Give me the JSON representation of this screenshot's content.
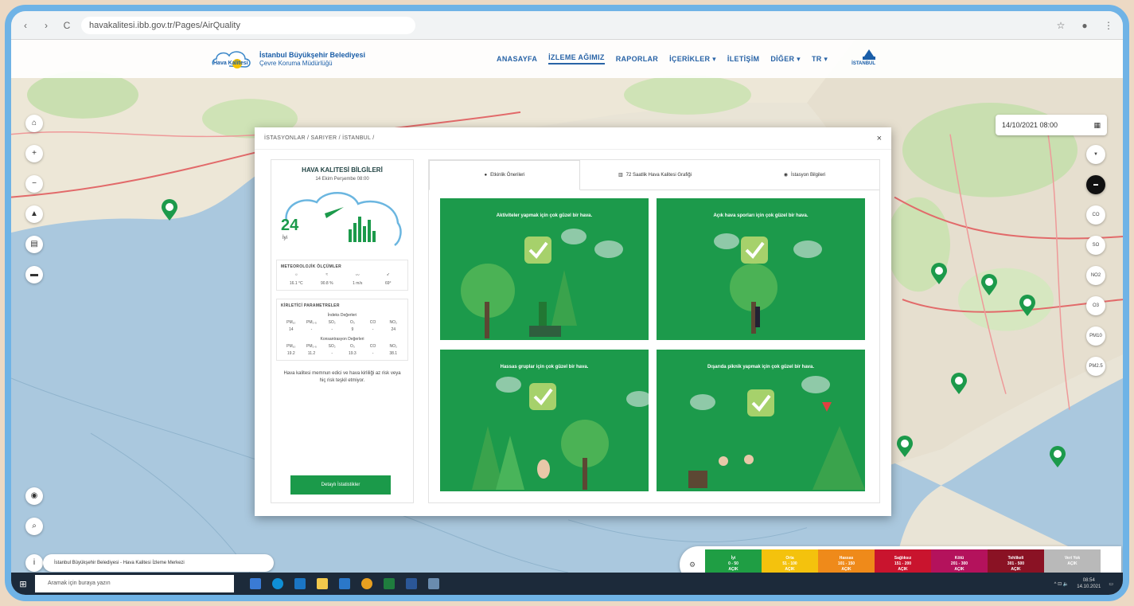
{
  "browser": {
    "url": "havakalitesi.ibb.gov.tr/Pages/AirQuality",
    "back_icon": "‹",
    "forward_icon": "›",
    "reload_icon": "C"
  },
  "header": {
    "logo_name": "Hava Kalitesi",
    "org_line1": "İstanbul Büyükşehir Belediyesi",
    "org_line2": "Çevre Koruma Müdürlüğü",
    "nav": [
      "ANASAYFA",
      "İZLEME AĞIMIZ",
      "RAPORLAR",
      "İÇERİKLER ▾",
      "İLETİŞİM",
      "DİĞER ▾",
      "TR ▾"
    ],
    "active_nav": "İZLEME AĞIMIZ",
    "ibb_label": "İSTANBUL"
  },
  "map": {
    "date": "14/10/2021 08:00",
    "right_buttons": [
      "",
      "",
      "CO",
      "SO",
      "NO2",
      "O3",
      "PM10",
      "PM2.5"
    ]
  },
  "modal": {
    "breadcrumb": "İSTASYONLAR / SARIYER / İSTANBUL /",
    "close": "×",
    "info": {
      "title": "HAVA KALITESİ BİLGİLERİ",
      "date": "14 Ekim Perşembe 08:00",
      "aqi": "24",
      "aqi_label": "İyi",
      "met_title": "METEOROLOJİK ÖLÇÜMLER",
      "met_icons": [
        "☼",
        "≈",
        "〰",
        "➶"
      ],
      "met_values": [
        "16.1 °C",
        "90.8 %",
        "1 m/s",
        "69°"
      ],
      "params_title": "KİRLETİCİ PARAMETRELER",
      "index_title": "İndeks Değerleri",
      "conc_title": "Konsantrasyon Değerleri",
      "param_names": [
        "PM₁₀",
        "PM₂.₅",
        "SO₂",
        "O₃",
        "CO",
        "NO₂"
      ],
      "index_values": [
        "14",
        "-",
        "-",
        "9",
        "-",
        "24"
      ],
      "conc_values": [
        "19.2",
        "11.2",
        "-",
        "19.3",
        "-",
        "38.1"
      ],
      "desc": "Hava kalitesi memnun edici ve hava kirliliği az risk veya hiç risk teşkil etmiyor.",
      "button": "Detaylı İstatistikler"
    },
    "tabs": [
      {
        "icon": "●",
        "label": "Etkinlik Önerileri"
      },
      {
        "icon": "▥",
        "label": "72 Saatlik Hava Kalitesi Grafiği"
      },
      {
        "icon": "◉",
        "label": "İstasyon Bilgileri"
      }
    ],
    "cards": [
      "Aktiviteler yapmak için çok güzel bir hava.",
      "Açık hava sporları için çok güzel bir hava.",
      "Hassas gruplar için çok güzel bir hava.",
      "Dışarıda piknik yapmak için çok güzel bir hava."
    ]
  },
  "source_text": "İstanbul Büyükşehir Belediyesi - Hava Kalitesi İzleme Merkezi",
  "legend": [
    {
      "name": "İyi",
      "range": "0 - 50",
      "state": "AÇIK",
      "color": "#1f9e44"
    },
    {
      "name": "Orta",
      "range": "51 - 100",
      "state": "AÇIK",
      "color": "#f4c20d"
    },
    {
      "name": "Hassas",
      "range": "101 - 150",
      "state": "AÇIK",
      "color": "#ef8a1a"
    },
    {
      "name": "Sağlıksız",
      "range": "151 - 200",
      "state": "AÇIK",
      "color": "#c9142e"
    },
    {
      "name": "Kötü",
      "range": "201 - 300",
      "state": "AÇIK",
      "color": "#b4125c"
    },
    {
      "name": "Tehlikeli",
      "range": "301 - 500",
      "state": "AÇIK",
      "color": "#8a1224"
    },
    {
      "name": "Veri Yok",
      "range": "",
      "state": "AÇIK",
      "color": "#b9b9b9"
    }
  ],
  "taskbar": {
    "search": "Aramak için buraya yazın",
    "time": "08:54",
    "date": "14.10.2021",
    "tray": "^ ⊡ 🔈"
  }
}
